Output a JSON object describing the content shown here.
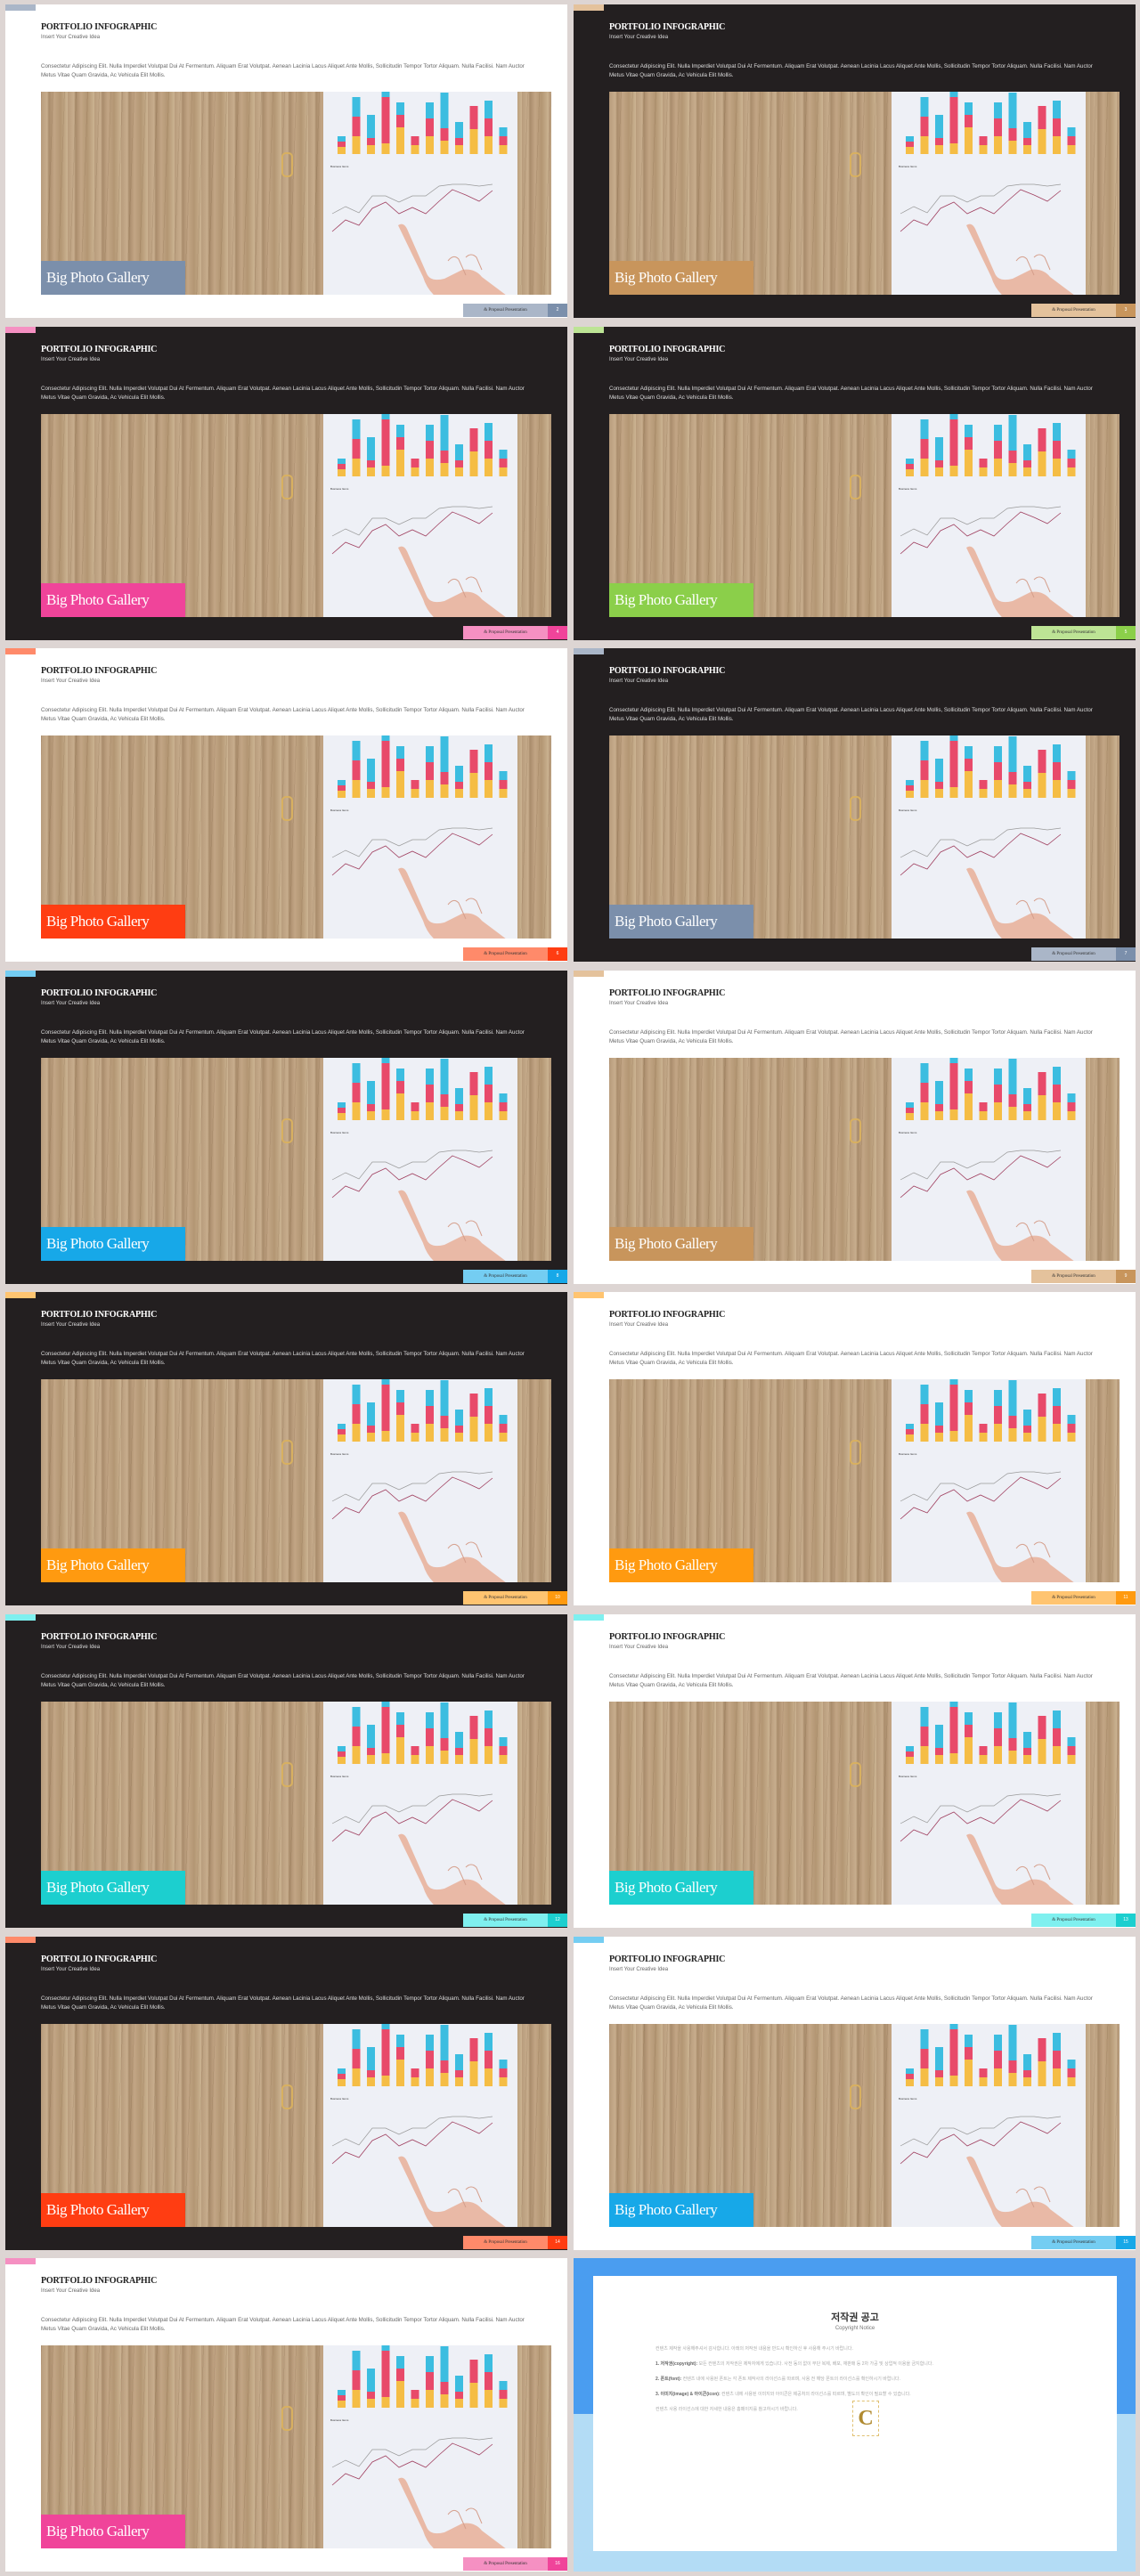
{
  "slide_common": {
    "title": "PORTFOLIO INFOGRAPHIC",
    "subtitle": "Insert Your Creative Idea",
    "body": "Consectetur Adipiscing Elit. Nulla Imperdiet Volutpat Dui At Fermentum. Aliquam Erat Volutpat. Aenean Lacinia Lacus Aliquet Ante Mollis, Sollicitudin Tempor Tortor Aliquam. Nulla Facilisi. Nam Auctor Metus Vitae Quam Gravida, Ac Vehicula Elit Mollis.",
    "gallery_label": "Big Photo Gallery",
    "footer_text": "& Proposal Presentation",
    "photo_chart_caption": "Business Items"
  },
  "slides": [
    {
      "theme": "light",
      "accent": "#7b8fab",
      "accent_light": "#aab6c8",
      "page": "2"
    },
    {
      "theme": "dark",
      "accent": "#c8955c",
      "accent_light": "#e4c29c",
      "page": "3"
    },
    {
      "theme": "dark",
      "accent": "#f0449a",
      "accent_light": "#f590c2",
      "page": "4"
    },
    {
      "theme": "dark",
      "accent": "#8bcf4a",
      "accent_light": "#bde495",
      "page": "5"
    },
    {
      "theme": "light",
      "accent": "#ff3d12",
      "accent_light": "#ff8a6a",
      "page": "6"
    },
    {
      "theme": "dark",
      "accent": "#7b8fab",
      "accent_light": "#aab6c8",
      "page": "7"
    },
    {
      "theme": "dark",
      "accent": "#17a8e8",
      "accent_light": "#74cdf2",
      "page": "8"
    },
    {
      "theme": "light",
      "accent": "#c8955c",
      "accent_light": "#e4c29c",
      "page": "9"
    },
    {
      "theme": "dark",
      "accent": "#ff9a10",
      "accent_light": "#ffc470",
      "page": "10"
    },
    {
      "theme": "light",
      "accent": "#ff9a10",
      "accent_light": "#ffc470",
      "page": "11"
    },
    {
      "theme": "dark",
      "accent": "#1ccfcf",
      "accent_light": "#7ff0ef",
      "page": "12"
    },
    {
      "theme": "light",
      "accent": "#1ccfcf",
      "accent_light": "#7ff0ef",
      "page": "13"
    },
    {
      "theme": "dark",
      "accent": "#ff3d12",
      "accent_light": "#ff8a6a",
      "page": "14"
    },
    {
      "theme": "light",
      "accent": "#17a8e8",
      "accent_light": "#74cdf2",
      "page": "15"
    },
    {
      "theme": "light",
      "accent": "#f0449a",
      "accent_light": "#f590c2",
      "page": "16"
    }
  ],
  "copyright": {
    "title": "저작권 공고",
    "subtitle": "Copyright Notice",
    "intro": "컨텐츠 제작을 사용해주셔서 감사합니다. 아래의 저작권 내용을 반드시 확인하신 후 사용해 주시기 바랍니다.",
    "sections": [
      {
        "heading": "1. 저작권(copyright):",
        "text": "모든 컨텐츠의 저작권은 제작자에게 있습니다. 사전 동의 없이 무단 복제, 배포, 재판매 등 2차 가공 및 상업적 이용을 금지합니다."
      },
      {
        "heading": "2. 폰트(font):",
        "text": "컨텐츠 내에 사용된 폰트는 각 폰트 제작사의 라이선스를 따르며, 사용 전 해당 폰트의 라이선스를 확인하시기 바랍니다."
      },
      {
        "heading": "3. 이미지(image) & 아이콘(icon):",
        "text": "컨텐츠 내에 사용된 이미지와 아이콘은 제공처의 라이선스를 따르며, 별도의 확인이 필요할 수 있습니다."
      }
    ],
    "outro": "컨텐츠 사용 라이선스에 대한 자세한 내용은 홈페이지를 참고하시기 바랍니다."
  }
}
